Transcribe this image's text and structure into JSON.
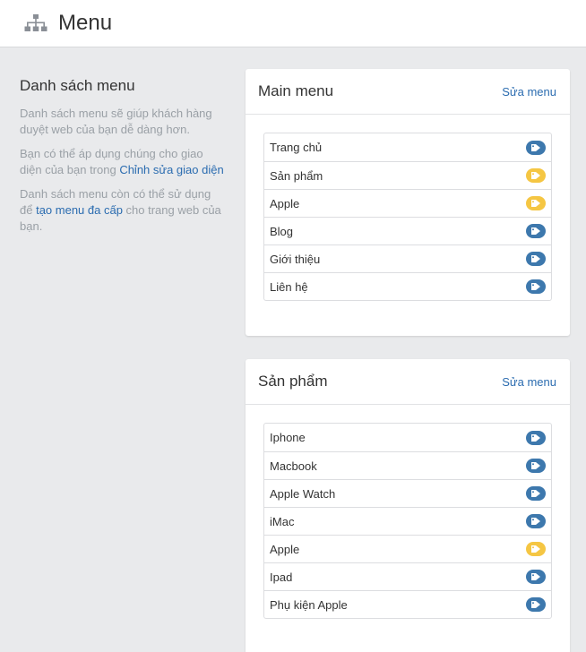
{
  "header": {
    "title": "Menu",
    "icon": "sitemap-icon"
  },
  "info": {
    "heading": "Danh sách menu",
    "p1": "Danh sách menu sẽ giúp khách hàng duyệt web của bạn dễ dàng hơn.",
    "p2_prefix": "Bạn có thể áp dụng chúng cho giao diện của bạn trong ",
    "p2_link": "Chỉnh sửa giao diện",
    "p3_prefix": "Danh sách menu còn có thể sử dụng để ",
    "p3_link": "tạo menu đa cấp",
    "p3_suffix": " cho trang web của bạn."
  },
  "colors": {
    "blue_tag": "#3d78ad",
    "yellow_tag": "#f5c643",
    "link": "#2b6cb0"
  },
  "menus": [
    {
      "title": "Main menu",
      "edit_label": "Sửa menu",
      "items": [
        {
          "label": "Trang chủ",
          "tag": "blue"
        },
        {
          "label": "Sản phẩm",
          "tag": "yellow"
        },
        {
          "label": "Apple",
          "tag": "yellow"
        },
        {
          "label": "Blog",
          "tag": "blue"
        },
        {
          "label": "Giới thiệu",
          "tag": "blue"
        },
        {
          "label": "Liên hệ",
          "tag": "blue"
        }
      ]
    },
    {
      "title": "Sản phẩm",
      "edit_label": "Sửa menu",
      "items": [
        {
          "label": "Iphone",
          "tag": "blue"
        },
        {
          "label": "Macbook",
          "tag": "blue"
        },
        {
          "label": "Apple Watch",
          "tag": "blue"
        },
        {
          "label": "iMac",
          "tag": "blue"
        },
        {
          "label": "Apple",
          "tag": "yellow"
        },
        {
          "label": "Ipad",
          "tag": "blue"
        },
        {
          "label": "Phụ kiện Apple",
          "tag": "blue"
        }
      ]
    }
  ]
}
